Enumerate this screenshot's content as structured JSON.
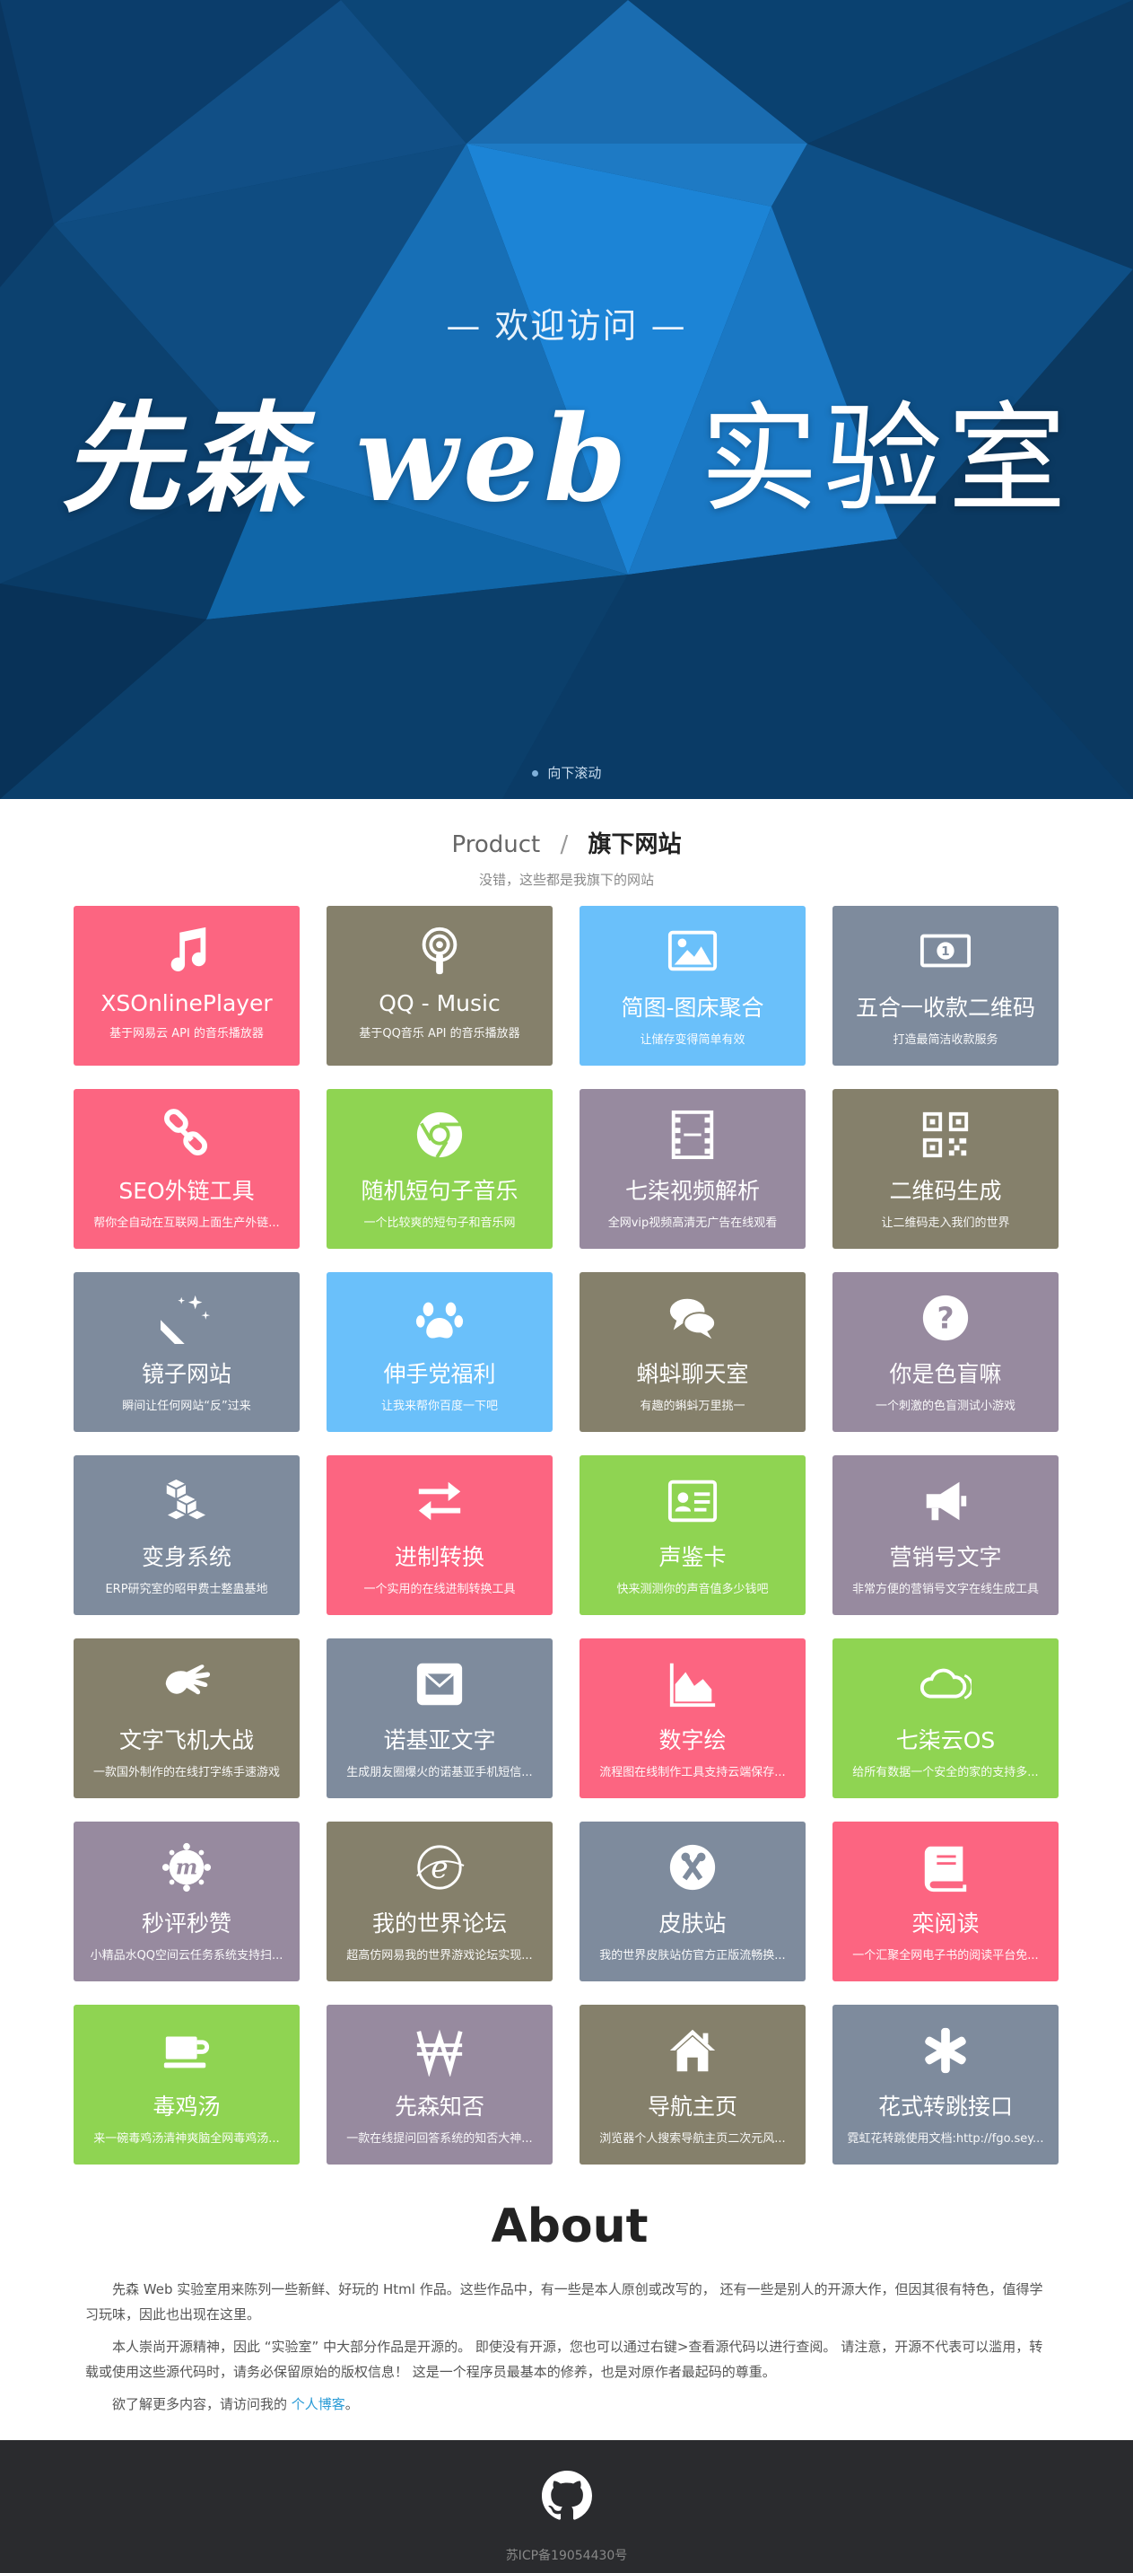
{
  "hero": {
    "subtitle": "— 欢迎访问 —",
    "title_1": "先森",
    "title_2": "web",
    "title_3": "实验室",
    "scroll_hint": "向下滚动"
  },
  "product": {
    "title_en": "Product",
    "separator": "/",
    "title_cn": "旗下网站",
    "description": "没错，这些都是我旗下的网站"
  },
  "colors": {
    "pink": "#fc6581",
    "olive": "#85806b",
    "sky": "#6ac0fa",
    "slate": "#7e8b9d",
    "green": "#8fd452",
    "mauve": "#978a9f",
    "footer": "#2a2b2e"
  },
  "cards": [
    {
      "name": "XSOnlinePlayer",
      "desc": "基于网易云 API 的音乐播放器",
      "icon": "music-note-icon",
      "color": "#fc6581"
    },
    {
      "name": "QQ - Music",
      "desc": "基于QQ音乐 API 的音乐播放器",
      "icon": "podcast-icon",
      "color": "#85806b"
    },
    {
      "name": "简图-图床聚合",
      "desc": "让储存变得简单有效",
      "icon": "image-icon",
      "color": "#6ac0fa"
    },
    {
      "name": "五合一收款二维码",
      "desc": "打造最简洁收款服务",
      "icon": "money-bill-icon",
      "color": "#7e8b9d"
    },
    {
      "name": "SEO外链工具",
      "desc": "帮你全自动在互联网上面生产外链...",
      "icon": "link-icon",
      "color": "#fc6581"
    },
    {
      "name": "随机短句子音乐",
      "desc": "一个比较爽的短句子和音乐网",
      "icon": "chrome-icon",
      "color": "#8fd452"
    },
    {
      "name": "七柒视频解析",
      "desc": "全网vip视频高清无广告在线观看",
      "icon": "film-icon",
      "color": "#978a9f"
    },
    {
      "name": "二维码生成",
      "desc": "让二维码走入我们的世界",
      "icon": "qrcode-icon",
      "color": "#85806b"
    },
    {
      "name": "镜子网站",
      "desc": "瞬间让任何网站“反”过来",
      "icon": "magic-wand-icon",
      "color": "#7e8b9d"
    },
    {
      "name": "伸手党福利",
      "desc": "让我来帮你百度一下吧",
      "icon": "paw-icon",
      "color": "#6ac0fa"
    },
    {
      "name": "蝌蚪聊天室",
      "desc": "有趣的蝌蚪万里挑一",
      "icon": "comments-icon",
      "color": "#85806b"
    },
    {
      "name": "你是色盲嘛",
      "desc": "一个刺激的色盲测试小游戏",
      "icon": "question-circle-icon",
      "color": "#978a9f"
    },
    {
      "name": "变身系统",
      "desc": "ERP研究室的昭甲费士整蛊基地",
      "icon": "cubes-icon",
      "color": "#7e8b9d"
    },
    {
      "name": "进制转换",
      "desc": "一个实用的在线进制转换工具",
      "icon": "exchange-icon",
      "color": "#fc6581"
    },
    {
      "name": "声鉴卡",
      "desc": "快来测测你的声音值多少钱吧",
      "icon": "id-card-icon",
      "color": "#8fd452"
    },
    {
      "name": "营销号文字",
      "desc": "非常方便的营销号文字在线生成工具",
      "icon": "bullhorn-icon",
      "color": "#978a9f"
    },
    {
      "name": "文字飞机大战",
      "desc": "一款国外制作的在线打字练手速游戏",
      "icon": "sign-language-icon",
      "color": "#85806b"
    },
    {
      "name": "诺基亚文字",
      "desc": "生成朋友圈爆火的诺基亚手机短信...",
      "icon": "envelope-icon",
      "color": "#7e8b9d"
    },
    {
      "name": "数字绘",
      "desc": "流程图在线制作工具支持云端保存...",
      "icon": "area-chart-icon",
      "color": "#fc6581"
    },
    {
      "name": "七柒云OS",
      "desc": "给所有数据一个安全的家的支持多...",
      "icon": "cloud-signal-icon",
      "color": "#8fd452"
    },
    {
      "name": "秒评秒赞",
      "desc": "小精品水QQ空间云任务系统支持扫...",
      "icon": "m-badge-icon",
      "color": "#978a9f"
    },
    {
      "name": "我的世界论坛",
      "desc": "超高仿网易我的世界游戏论坛实现...",
      "icon": "e-logo-icon",
      "color": "#85806b"
    },
    {
      "name": "皮肤站",
      "desc": "我的世界皮肤站仿官方正版流畅换...",
      "icon": "tools-icon",
      "color": "#7e8b9d"
    },
    {
      "name": "栾阅读",
      "desc": "一个汇聚全网电子书的阅读平台免...",
      "icon": "book-icon",
      "color": "#fc6581"
    },
    {
      "name": "毒鸡汤",
      "desc": "来一碗毒鸡汤清神爽脑全网毒鸡汤...",
      "icon": "coffee-icon",
      "color": "#8fd452"
    },
    {
      "name": "先森知否",
      "desc": "一款在线提问回答系统的知否大神...",
      "icon": "won-sign-icon",
      "color": "#978a9f"
    },
    {
      "name": "导航主页",
      "desc": "浏览器个人搜索导航主页二次元风...",
      "icon": "home-icon",
      "color": "#85806b"
    },
    {
      "name": "花式转跳接口",
      "desc": "霓虹花转跳使用文档:http://fgo.sey...",
      "icon": "asterisk-icon",
      "color": "#7e8b9d"
    }
  ],
  "about": {
    "title": "About",
    "p1": "先森 Web 实验室用来陈列一些新鲜、好玩的 Html 作品。这些作品中，有一些是本人原创或改写的， 还有一些是别人的开源大作，但因其很有特色，值得学习玩味，因此也出现在这里。",
    "p2": "本人崇尚开源精神，因此 “实验室” 中大部分作品是开源的。 即使没有开源，您也可以通过右键>查看源代码以进行查阅。 请注意，开源不代表可以滥用，转载或使用这些源代码时，请务必保留原始的版权信息！ 这是一个程序员最基本的修养，也是对原作者最起码的尊重。",
    "p3_prefix": "欲了解更多内容，请访问我的 ",
    "p3_link": "个人博客",
    "p3_suffix": "。"
  },
  "footer": {
    "icon": "github-icon",
    "icp": "苏ICP备19054430号"
  }
}
